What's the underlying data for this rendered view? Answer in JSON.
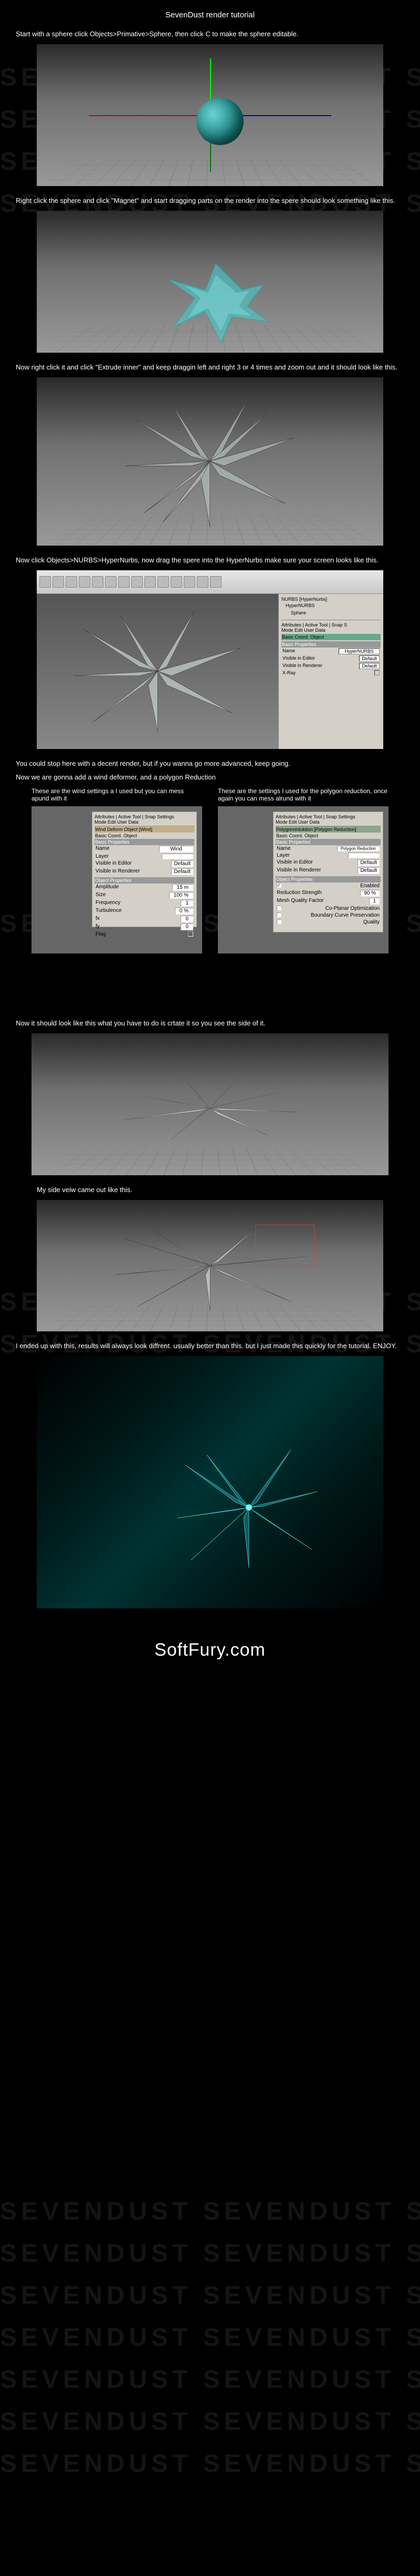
{
  "title": "SevenDust render tutorial",
  "steps": {
    "s1": "Start with a sphere click Objects>Primative>Sphere, then click C to make the sphere editable.",
    "s2": "Right click the sphere and click \"Magnet\" and start dragging parts on the render into the spere should look something like this.",
    "s3": "Now right click it and click \"Extrude inner\" and keep draggin left and right 3 or 4 times and zoom out and it should look like this.",
    "s4": "Now click Objects>NURBS>HyperNurbs, now drag the spere into the HyperNurbs make sure your screen looks like this.",
    "s5": "You could stop here with a decent render, but if you wanna go more advanced, keep going.",
    "s6": "Now we are gonna add a wind deformer, and a polygon Reduction",
    "wind_text": "These are the wind settings a I used but you can mess apund with it",
    "poly_text": "These are the settings I used for the polygon reduction, once again you can mess alrund with it",
    "s7": "Now it should look like this what you have to do is crtate it so you see the side of it.",
    "s8": "My side veiw came out like this.",
    "s9": "I ended up with this, results will always look diffrent. usually better than this. but I just made this quickly for the tutorial. ENJOY."
  },
  "panel_wind": {
    "tabs": "Attributes | Active Tool | Snap Settings",
    "mode": "Mode  Edit  User Data",
    "obj_title": "Wind Deform Object [Wind]",
    "tab2": "Basic  Coord.  Object",
    "basic_heading": "Basic Properties",
    "name_label": "Name",
    "name_val": "Wind",
    "layer_label": "Layer",
    "vis1": "Visible in Editor",
    "vis2": "Visible in Renderer",
    "obj_heading": "Object Properties",
    "amp_label": "Amplitude",
    "amp_val": "15 m",
    "size_label": "Size",
    "size_val": "100 %",
    "freq_label": "Frequency",
    "freq_val": "1",
    "turb_label": "Turbulence",
    "turb_val": "0 %",
    "fx_label": "fx",
    "fx_val": "0",
    "fy_label": "fy",
    "fy_val": "0",
    "flag_label": "Flag",
    "default": "Default"
  },
  "panel_poly": {
    "tabs": "Attributes | Active Tool | Snap Settings",
    "mode": "Mode  Edit  User Data",
    "obj_title": "Polygonreduktion [Polygon Reduction]",
    "tab2": "Basic  Coord.  Object",
    "basic_heading": "Basic Properties",
    "name_label": "Name",
    "name_val": "Polygon Reduction",
    "layer_label": "Layer",
    "vis1": "Visible in Editor",
    "vis2": "Visible in Renderer",
    "obj_heading": "Object Properties",
    "enabled": "Enabled",
    "red_label": "Reduction Strength",
    "red_val": "90 %",
    "mesh_label": "Mesh Quality Factor",
    "mesh_val": "1",
    "cp1": "Co-Planar Optimization",
    "cp2": "Boundary Curve Preservation",
    "cp3": "Quality",
    "default": "Default"
  },
  "c4d": {
    "side_title": "NURBS [HyperNurbs]",
    "side_obj": "HyperNURBS",
    "side_sphere": "Sphere",
    "attr": "Attributes | Active Tool | Snap S",
    "mode": "Mode  Edit  User Data",
    "basic": "Basic  Coord.  Object",
    "basic_heading": "Basic Properties",
    "name_label": "Name",
    "name_val": "HyperNURBS",
    "vis1": "Visible in Editor",
    "vis2": "Visible in Renderer",
    "xray": "X-Ray",
    "default": "Default"
  },
  "footer": "SoftFury.com",
  "watermark": "SEVENDUST  SEVENDUST  SEVENDUST"
}
